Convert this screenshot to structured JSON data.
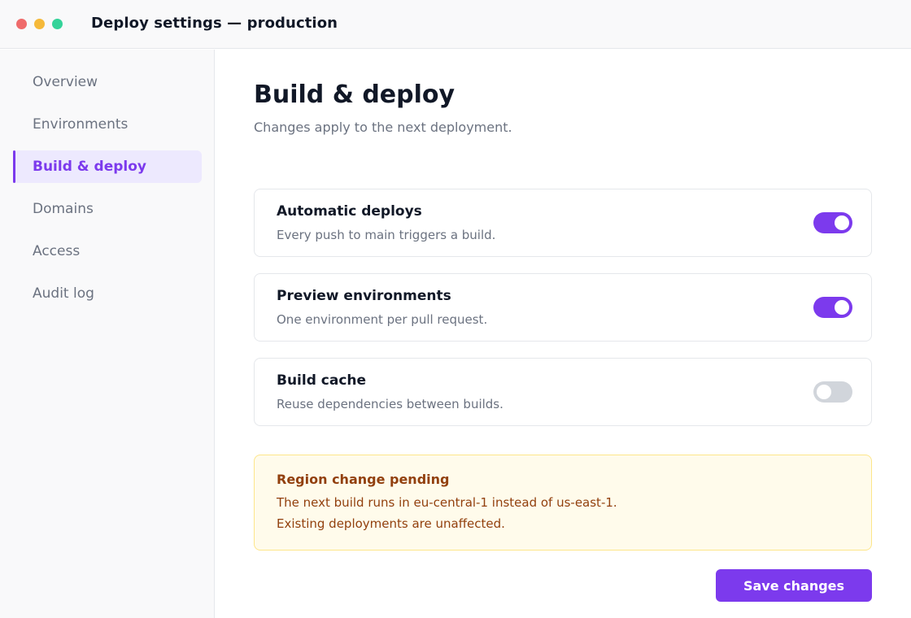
{
  "window": {
    "title": "Deploy settings — production",
    "traffic_lights": [
      {
        "name": "close",
        "color": "#ef6b6b"
      },
      {
        "name": "minimize",
        "color": "#f5b93a"
      },
      {
        "name": "zoom",
        "color": "#34d399"
      }
    ]
  },
  "sidebar": {
    "items": [
      {
        "label": "Overview",
        "active": false
      },
      {
        "label": "Environments",
        "active": false
      },
      {
        "label": "Build & deploy",
        "active": true
      },
      {
        "label": "Domains",
        "active": false
      },
      {
        "label": "Access",
        "active": false
      },
      {
        "label": "Audit log",
        "active": false
      }
    ]
  },
  "main": {
    "title": "Build & deploy",
    "subtitle": "Changes apply to the next deployment.",
    "settings": [
      {
        "title": "Automatic deploys",
        "description": "Every push to main triggers a build.",
        "enabled": true
      },
      {
        "title": "Preview environments",
        "description": "One environment per pull request.",
        "enabled": true
      },
      {
        "title": "Build cache",
        "description": "Reuse dependencies between builds.",
        "enabled": false
      }
    ],
    "alert": {
      "title": "Region change pending",
      "lines": [
        "The next build runs in eu-central-1 instead of us-east-1.",
        "Existing deployments are unaffected."
      ]
    },
    "save_label": "Save changes"
  },
  "colors": {
    "accent": "#7c3aed",
    "toggle_on": "#7c3aed",
    "toggle_off": "#d1d5db",
    "alert_bg": "#fffbeb",
    "alert_border": "#fde68a",
    "alert_text": "#92400e"
  }
}
